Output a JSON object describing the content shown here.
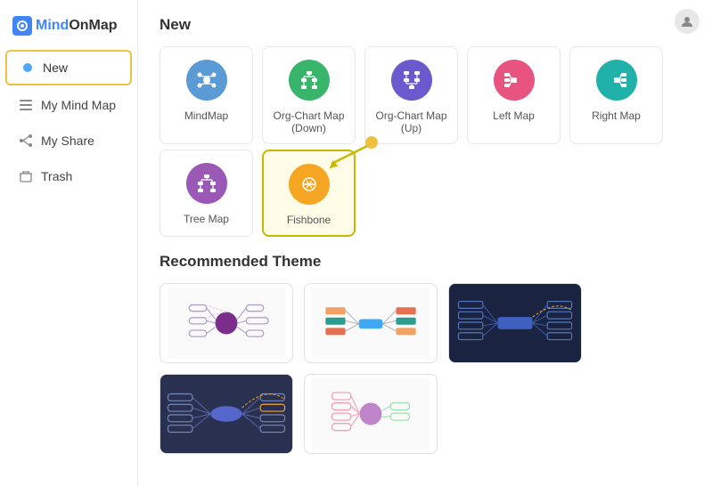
{
  "logo": {
    "text_m": "M",
    "text_full": "indOnMap"
  },
  "sidebar": {
    "items": [
      {
        "id": "new",
        "label": "New",
        "icon": "dot",
        "active": true
      },
      {
        "id": "my-mind-map",
        "label": "My Mind Map",
        "icon": "list",
        "active": false
      },
      {
        "id": "my-share",
        "label": "My Share",
        "icon": "share",
        "active": false
      },
      {
        "id": "trash",
        "label": "Trash",
        "icon": "trash",
        "active": false
      }
    ]
  },
  "main": {
    "new_section_title": "New",
    "recommended_section_title": "Recommended Theme",
    "map_types": [
      {
        "id": "mindmap",
        "label": "MindMap",
        "color": "#5b9bd5",
        "icon": "mindmap"
      },
      {
        "id": "org-chart-down",
        "label": "Org-Chart Map (Down)",
        "color": "#38b56a",
        "icon": "org-down"
      },
      {
        "id": "org-chart-up",
        "label": "Org-Chart Map (Up)",
        "color": "#6a5acd",
        "icon": "org-up"
      },
      {
        "id": "left-map",
        "label": "Left Map",
        "color": "#e75480",
        "icon": "left"
      },
      {
        "id": "right-map",
        "label": "Right Map",
        "color": "#20b2aa",
        "icon": "right"
      },
      {
        "id": "tree-map",
        "label": "Tree Map",
        "color": "#9b59b6",
        "icon": "tree"
      },
      {
        "id": "fishbone",
        "label": "Fishbone",
        "color": "#f5a623",
        "icon": "fishbone",
        "highlighted": true
      }
    ],
    "themes": [
      {
        "id": "theme1",
        "bg": "#fff",
        "type": "light-purple"
      },
      {
        "id": "theme2",
        "bg": "#fff",
        "type": "light-colorful"
      },
      {
        "id": "theme3",
        "bg": "#1a2340",
        "type": "dark-blue"
      },
      {
        "id": "theme4",
        "bg": "#2a3050",
        "type": "dark-navy"
      },
      {
        "id": "theme5",
        "bg": "#fff",
        "type": "light-pink"
      }
    ]
  }
}
